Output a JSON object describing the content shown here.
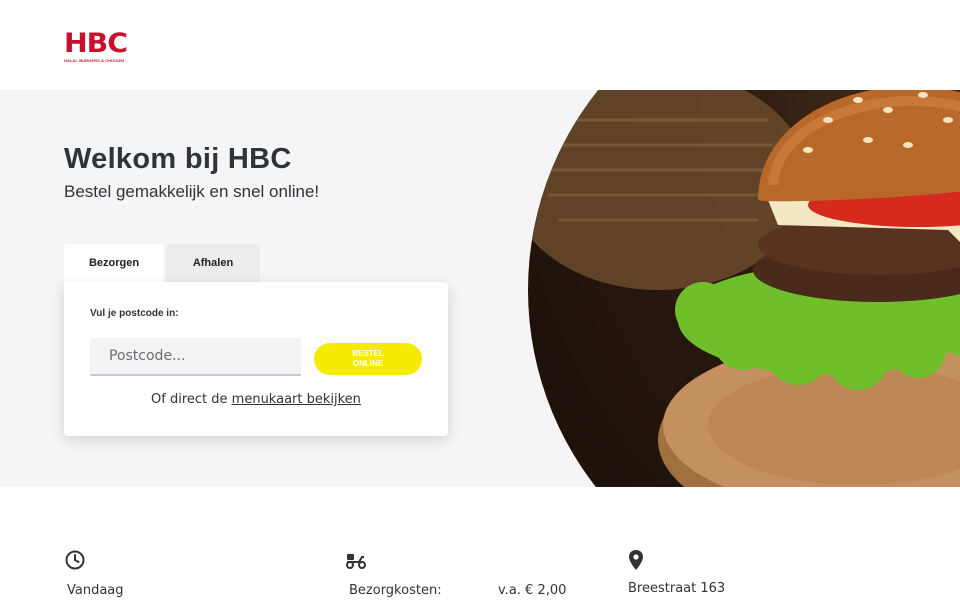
{
  "header": {
    "logo_text": "HBC",
    "logo_tagline": "HALAL BURGERS & CHICKEN"
  },
  "hero": {
    "title": "Welkom bij HBC",
    "subtitle": "Bestel gemakkelijk en snel online!",
    "image_alt": "burger-photo"
  },
  "order": {
    "tabs": [
      {
        "label": "Bezorgen",
        "active": true
      },
      {
        "label": "Afhalen",
        "active": false
      }
    ],
    "postcode_label": "Vul je postcode in:",
    "postcode_placeholder": "Postcode...",
    "order_button_label": "BESTEL ONLINE",
    "menu_prefix": "Of direct de ",
    "menu_link": "menukaart bekijken"
  },
  "info": {
    "hours": {
      "icon": "clock-icon",
      "label": "Vandaag"
    },
    "delivery": {
      "icon": "scooter-icon",
      "label": "Bezorgkosten:",
      "value": "v.a. € 2,00"
    },
    "address": {
      "icon": "location-pin-icon",
      "line1": "Breestraat 163"
    }
  },
  "colors": {
    "brand_red": "#c8102e",
    "button_yellow": "#f5eb00",
    "hero_bg": "#f5f5f7"
  }
}
